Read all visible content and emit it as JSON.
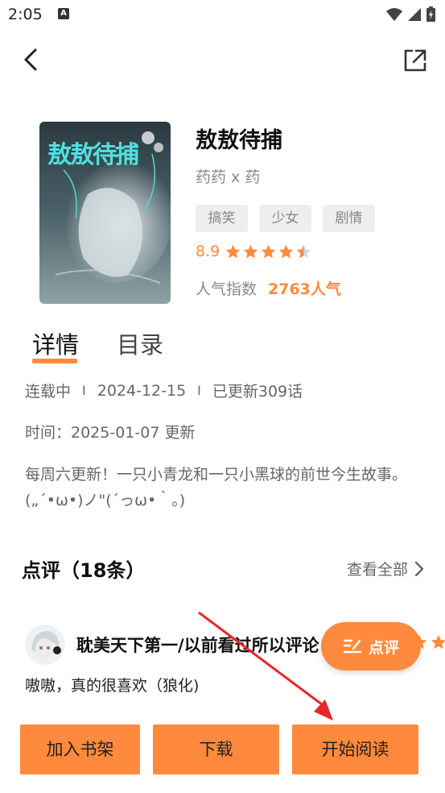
{
  "status_bar": {
    "time": "2:05",
    "notification_icon": "A"
  },
  "navigation": {
    "back_icon": "back-icon",
    "share_icon": "share-icon"
  },
  "book": {
    "title": "敖敖待捕",
    "author": "药药 x 药",
    "tags": [
      "搞笑",
      "少女",
      "剧情"
    ],
    "rating_score": "8.9",
    "rating_stars": 4.5,
    "popularity_label": "人气指数",
    "popularity_value": "2763人气",
    "cover_text": "敖敖待捕"
  },
  "tabs": {
    "details": "详情",
    "toc": "目录"
  },
  "details": {
    "status": "连载中",
    "date": "2024-12-15",
    "updated": "已更新309话",
    "time_line": "时间：2025-01-07 更新",
    "description": "每周六更新！一只小青龙和一只小黑球的前世今生故事。(„´•ω•)ノ\"(´っω•｀。)"
  },
  "reviews": {
    "header": "点评（18条）",
    "view_all": "查看全部",
    "items": [
      {
        "user": "耽美天下第一/以前看过所以评论",
        "text": "嗷嗷，真的很喜欢（狼化)",
        "stars": 5
      }
    ]
  },
  "fab": {
    "label": "点评"
  },
  "actions": {
    "add_shelf": "加入书架",
    "download": "下载",
    "start_reading": "开始阅读"
  },
  "colors": {
    "accent": "#ff8a3d",
    "annotation_arrow": "#e8262a"
  }
}
